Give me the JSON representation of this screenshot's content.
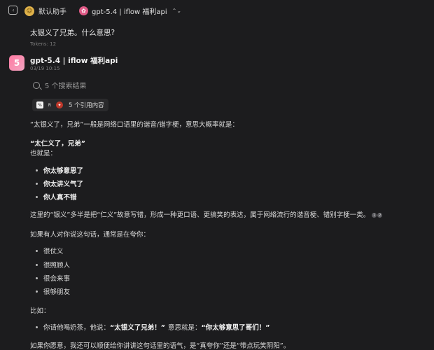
{
  "header": {
    "assistant_name": "默认助手",
    "model_name": "gpt-5.4 | iflow 福利api"
  },
  "user_message": {
    "text": "太银义了兄弟。什么意思?",
    "tokens": "Tokens: 12"
  },
  "bot_message": {
    "avatar_char": "5",
    "name": "gpt-5.4 | iflow 福利api",
    "time": "03/19 10:15",
    "search_results": "5 个搜索结果",
    "citations_label": "5 个引用内容",
    "intro": "“太银义了，兄弟”一般是网络口语里的谐音/错字梗，意思大概率就是：",
    "heading": "“太仁义了，兄弟”",
    "also": "也就是：",
    "list1": [
      "你太够意思了",
      "你太讲义气了",
      "你人真不错"
    ],
    "explain": "这里的“银义”多半是把“仁义”故意写错，形成一种更口语、更搞笑的表达，属于网络流行的谐音梗、错别字梗一类。",
    "sup": [
      "1",
      "2"
    ],
    "if_someone": "如果有人对你说这句话，通常是在夸你：",
    "list2": [
      "很仗义",
      "很照顾人",
      "很会来事",
      "很够朋友"
    ],
    "example_label": "比如：",
    "example_prefix": "你请他喝奶茶，他说：",
    "example_quote1": "“太银义了兄弟！”",
    "example_mid": "意思就是：",
    "example_quote2": "“你太够意思了哥们！”",
    "closing": "如果你愿意，我还可以顺便给你讲讲这句话里的语气，是“真夸你”还是“带点玩笑阴阳”。"
  },
  "colors": {
    "background": "#1c1c1e",
    "avatar_gradient_start": "#ff7aa2",
    "assistant_chip": "#e0b24a"
  }
}
